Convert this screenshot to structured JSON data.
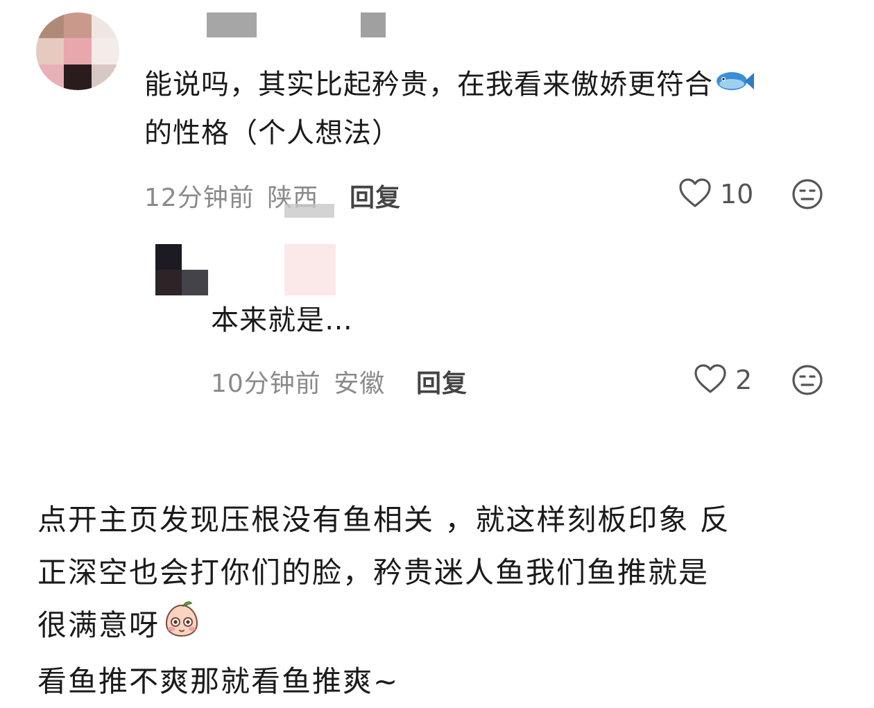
{
  "comment": {
    "text_line1": "能说吗，其实比起矜贵，在我看来傲娇更符合",
    "text_line2": "的性格（个人想法）",
    "emoji_icon": "fish-icon",
    "time": "12分钟前",
    "location": "陕西",
    "reply_label": "回复",
    "like_count": "10"
  },
  "reply": {
    "text": "本来就是…",
    "time": "10分钟前",
    "location": "安徽",
    "reply_label": "回复",
    "like_count": "2"
  },
  "post_body": {
    "line1": "点开主页发现压根没有鱼相关 ，就这样刻板印象 反",
    "line2": "正深空也会打你们的脸，矜贵迷人鱼我们鱼推就是",
    "line3": "很满意呀",
    "line3_emoji_icon": "peach-face-emoji-icon",
    "line4": "看鱼推不爽那就看鱼推爽~"
  },
  "colors": {
    "text": "#1a1a1a",
    "meta": "#8a8a8a",
    "icon": "#555555"
  }
}
